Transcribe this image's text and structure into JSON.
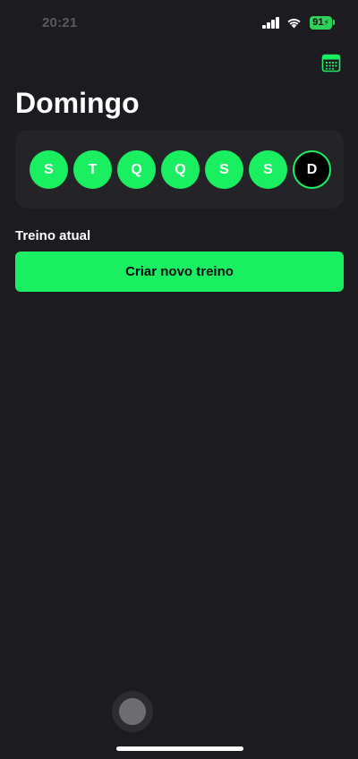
{
  "status_bar": {
    "time": "20:21",
    "battery_level": "91",
    "battery_charging": true,
    "icons": [
      "signal-icon",
      "wifi-icon",
      "battery-icon"
    ]
  },
  "header": {
    "title": "Domingo",
    "calendar_icon": "calendar-icon"
  },
  "week": {
    "days": [
      {
        "label": "S",
        "completed": true
      },
      {
        "label": "T",
        "completed": true
      },
      {
        "label": "Q",
        "completed": true
      },
      {
        "label": "Q",
        "completed": true
      },
      {
        "label": "S",
        "completed": true
      },
      {
        "label": "S",
        "completed": true
      },
      {
        "label": "D",
        "completed": false,
        "selected": true
      }
    ]
  },
  "current_workout": {
    "label": "Treino atual",
    "button_label": "Criar novo treino"
  },
  "colors": {
    "background": "#1c1b1f",
    "card": "#242328",
    "accent": "#1aef62",
    "battery": "#30d158"
  }
}
